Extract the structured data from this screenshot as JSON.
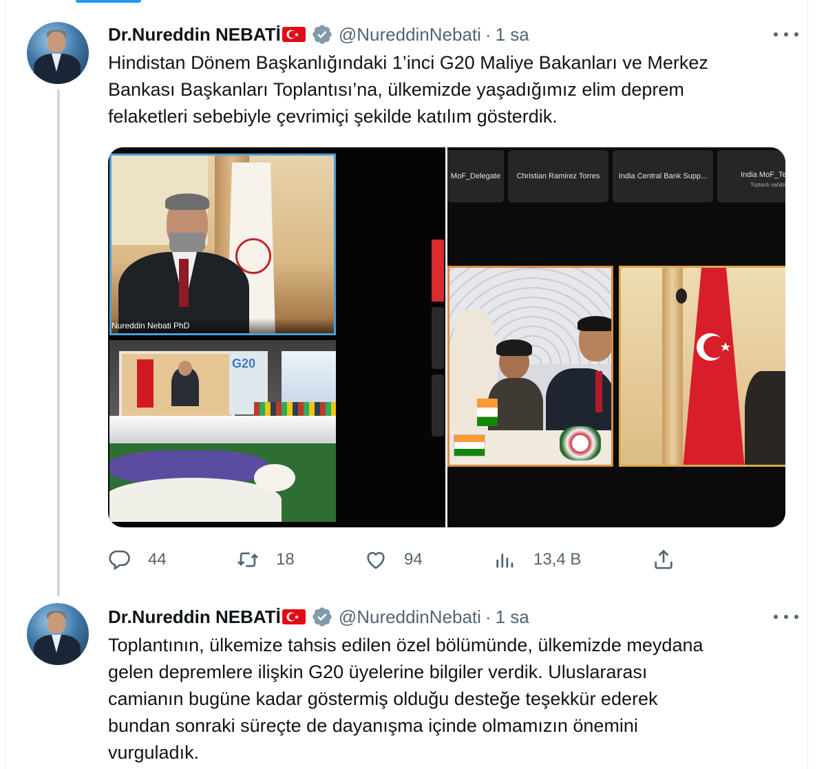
{
  "tweets": [
    {
      "author_name": "Dr.Nureddin NEBATİ",
      "handle": "@NureddinNebati",
      "separator": "·",
      "time": "1 sa",
      "text_lines": [
        "Hindistan Dönem Başkanlığındaki 1’inci G20 Maliye Bakanları ve Merkez",
        "Bankası Başkanları Toplantısı’na, ülkemizde yaşadığımız elim deprem",
        "felaketleri sebebiyle çevrimiçi şekilde katılım gösterdik."
      ],
      "media": {
        "participant_name": "Nureddin Nebati PhD",
        "tiles": [
          "MoF_Delegate",
          "Christian Ramirez Torres",
          "India Central Bank Supp...",
          "India MoF_Te"
        ],
        "tile_sub": "Toplantı sahibi",
        "banner": "G20"
      },
      "actions": {
        "replies": "44",
        "retweets": "18",
        "likes": "94",
        "views": "13,4 B"
      }
    },
    {
      "author_name": "Dr.Nureddin NEBATİ",
      "handle": "@NureddinNebati",
      "separator": "·",
      "time": "1 sa",
      "text_lines": [
        "Toplantının, ülkemize tahsis edilen özel bölümünde, ülkemizde meydana",
        "gelen depremlere ilişkin G20 üyelerine bilgiler verdik. Uluslararası",
        "camianın bugüne kadar göstermiş olduğu desteğe teşekkür ederek",
        "bundan sonraki süreçte de dayanışma içinde olmamızın önemini",
        "vurguladık."
      ]
    }
  ],
  "icons": {
    "verified": "verified-badge-icon",
    "reply": "reply-icon",
    "retweet": "retweet-icon",
    "like": "heart-icon",
    "views": "views-icon",
    "share": "share-icon",
    "more": "more-icon"
  },
  "colors": {
    "text": "#0f1419",
    "secondary": "#536471",
    "accent": "#1d9bf0",
    "flag_red": "#e30a17",
    "thread_line": "#cfd9de"
  }
}
